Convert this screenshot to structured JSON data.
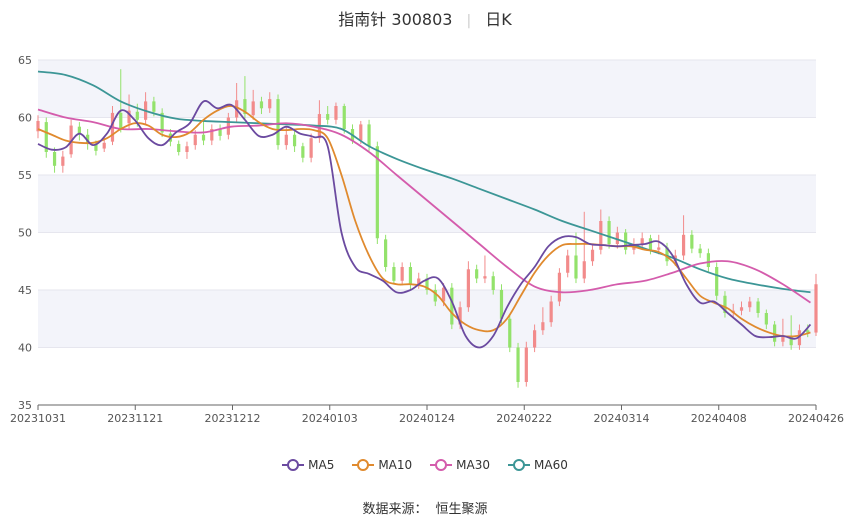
{
  "header": {
    "name": "指南针 300803",
    "period": "日K"
  },
  "source": {
    "label": "数据来源：",
    "provider": "恒生聚源"
  },
  "colors": {
    "up": "#f28b8b",
    "down": "#93e26b",
    "ma5": "#6b4aa0",
    "ma10": "#e08a2e",
    "ma30": "#d45cac",
    "ma60": "#3c9696",
    "band": "#f3f4fa",
    "grid": "#e6e6ee"
  },
  "chart_data": {
    "type": "candlestick",
    "y_ticks": [
      65,
      60,
      55,
      50,
      45,
      40,
      35
    ],
    "ylim": [
      35,
      65
    ],
    "x_ticks": [
      "20231031",
      "20231121",
      "20231212",
      "20240103",
      "20240124",
      "20240222",
      "20240314",
      "20240408",
      "20240426"
    ],
    "legend_position": "bottom",
    "ma_labels": {
      "ma5": "MA5",
      "ma10": "MA10",
      "ma30": "MA30",
      "ma60": "MA60"
    },
    "ma5": [
      [
        0,
        57.7
      ],
      [
        5,
        57.2
      ],
      [
        10,
        57.4
      ],
      [
        15,
        58.6
      ],
      [
        20,
        57.6
      ],
      [
        25,
        58.6
      ],
      [
        30,
        60.6
      ],
      [
        35,
        59.8
      ],
      [
        40,
        58.2
      ],
      [
        45,
        57.6
      ],
      [
        50,
        58.7
      ],
      [
        55,
        59.5
      ],
      [
        60,
        61.4
      ],
      [
        65,
        60.8
      ],
      [
        70,
        61.1
      ],
      [
        75,
        59.8
      ],
      [
        80,
        58.4
      ],
      [
        85,
        58.5
      ],
      [
        90,
        59.2
      ],
      [
        95,
        58.6
      ],
      [
        100,
        58.3
      ],
      [
        105,
        57.5
      ],
      [
        110,
        50.0
      ],
      [
        115,
        47.0
      ],
      [
        120,
        46.4
      ],
      [
        125,
        45.8
      ],
      [
        130,
        44.8
      ],
      [
        135,
        45.0
      ],
      [
        140,
        45.8
      ],
      [
        145,
        46.0
      ],
      [
        150,
        44.0
      ],
      [
        155,
        41.0
      ],
      [
        160,
        40.0
      ],
      [
        165,
        41.0
      ],
      [
        170,
        43.5
      ],
      [
        175,
        45.5
      ],
      [
        180,
        47.0
      ],
      [
        185,
        48.8
      ],
      [
        190,
        49.6
      ],
      [
        195,
        49.6
      ],
      [
        200,
        49.0
      ],
      [
        205,
        48.9
      ],
      [
        210,
        48.8
      ],
      [
        215,
        48.9
      ],
      [
        220,
        49.0
      ],
      [
        225,
        49.2
      ],
      [
        230,
        48.0
      ],
      [
        235,
        45.5
      ],
      [
        240,
        43.9
      ],
      [
        245,
        44.0
      ],
      [
        250,
        43.0
      ],
      [
        255,
        42.0
      ],
      [
        260,
        41.0
      ],
      [
        265,
        40.9
      ],
      [
        270,
        41.0
      ],
      [
        275,
        40.8
      ],
      [
        280,
        42.0
      ]
    ],
    "ma10": [
      [
        0,
        59.0
      ],
      [
        5,
        58.5
      ],
      [
        10,
        58.0
      ],
      [
        15,
        57.8
      ],
      [
        20,
        57.8
      ],
      [
        25,
        58.2
      ],
      [
        30,
        59.0
      ],
      [
        35,
        59.5
      ],
      [
        40,
        59.3
      ],
      [
        45,
        58.5
      ],
      [
        50,
        58.3
      ],
      [
        55,
        58.7
      ],
      [
        60,
        59.8
      ],
      [
        65,
        60.6
      ],
      [
        70,
        61.0
      ],
      [
        75,
        60.5
      ],
      [
        80,
        59.6
      ],
      [
        85,
        59.0
      ],
      [
        90,
        58.9
      ],
      [
        95,
        59.0
      ],
      [
        100,
        58.9
      ],
      [
        105,
        58.2
      ],
      [
        110,
        55.0
      ],
      [
        115,
        51.0
      ],
      [
        120,
        48.0
      ],
      [
        125,
        46.0
      ],
      [
        130,
        45.5
      ],
      [
        135,
        45.5
      ],
      [
        140,
        45.3
      ],
      [
        145,
        44.5
      ],
      [
        150,
        43.0
      ],
      [
        155,
        42.0
      ],
      [
        160,
        41.5
      ],
      [
        165,
        41.5
      ],
      [
        170,
        42.5
      ],
      [
        175,
        44.5
      ],
      [
        180,
        46.5
      ],
      [
        185,
        48.0
      ],
      [
        190,
        48.9
      ],
      [
        195,
        49.0
      ],
      [
        200,
        49.0
      ],
      [
        205,
        48.9
      ],
      [
        210,
        48.8
      ],
      [
        215,
        48.8
      ],
      [
        220,
        48.5
      ],
      [
        225,
        48.3
      ],
      [
        230,
        47.5
      ],
      [
        235,
        46.0
      ],
      [
        240,
        44.5
      ],
      [
        245,
        43.9
      ],
      [
        250,
        43.4
      ],
      [
        255,
        42.5
      ],
      [
        260,
        41.8
      ],
      [
        265,
        41.3
      ],
      [
        270,
        41.0
      ],
      [
        275,
        41.0
      ],
      [
        280,
        41.3
      ]
    ],
    "ma30": [
      [
        0,
        60.7
      ],
      [
        10,
        60.0
      ],
      [
        20,
        59.6
      ],
      [
        30,
        59.0
      ],
      [
        40,
        59.0
      ],
      [
        50,
        58.8
      ],
      [
        60,
        58.7
      ],
      [
        70,
        59.2
      ],
      [
        80,
        59.3
      ],
      [
        90,
        59.5
      ],
      [
        100,
        59.2
      ],
      [
        110,
        58.5
      ],
      [
        120,
        57.0
      ],
      [
        130,
        55.0
      ],
      [
        140,
        53.0
      ],
      [
        150,
        51.0
      ],
      [
        160,
        49.0
      ],
      [
        170,
        47.0
      ],
      [
        180,
        45.3
      ],
      [
        190,
        44.8
      ],
      [
        200,
        45.0
      ],
      [
        210,
        45.5
      ],
      [
        220,
        45.8
      ],
      [
        230,
        46.5
      ],
      [
        240,
        47.3
      ],
      [
        250,
        47.5
      ],
      [
        260,
        46.8
      ],
      [
        270,
        45.5
      ],
      [
        280,
        43.9
      ]
    ],
    "ma60": [
      [
        0,
        64.0
      ],
      [
        10,
        63.7
      ],
      [
        20,
        62.8
      ],
      [
        30,
        61.4
      ],
      [
        40,
        60.5
      ],
      [
        50,
        59.9
      ],
      [
        60,
        59.7
      ],
      [
        70,
        59.6
      ],
      [
        80,
        59.5
      ],
      [
        90,
        59.4
      ],
      [
        100,
        59.3
      ],
      [
        110,
        59.0
      ],
      [
        120,
        57.5
      ],
      [
        130,
        56.4
      ],
      [
        140,
        55.5
      ],
      [
        150,
        54.7
      ],
      [
        160,
        53.8
      ],
      [
        170,
        52.9
      ],
      [
        180,
        52.0
      ],
      [
        190,
        51.0
      ],
      [
        200,
        50.2
      ],
      [
        210,
        49.4
      ],
      [
        220,
        48.6
      ],
      [
        230,
        47.8
      ],
      [
        240,
        46.8
      ],
      [
        250,
        46.0
      ],
      [
        260,
        45.5
      ],
      [
        270,
        45.1
      ],
      [
        280,
        44.8
      ]
    ],
    "candles_note_only": "",
    "candles": [
      [
        0,
        58.8,
        59.7,
        58.2,
        60.2
      ],
      [
        3,
        59.6,
        57.0,
        56.5,
        60.0
      ],
      [
        6,
        57.0,
        55.8,
        55.2,
        57.4
      ],
      [
        9,
        55.8,
        56.6,
        55.2,
        57.1
      ],
      [
        12,
        56.8,
        59.3,
        56.5,
        59.8
      ],
      [
        15,
        59.2,
        58.6,
        58.0,
        59.6
      ],
      [
        18,
        58.5,
        57.8,
        57.2,
        59.0
      ],
      [
        21,
        57.7,
        57.1,
        56.7,
        58.0
      ],
      [
        24,
        57.3,
        57.8,
        57.0,
        58.3
      ],
      [
        27,
        57.9,
        60.4,
        57.6,
        61.0
      ],
      [
        30,
        60.4,
        59.0,
        58.7,
        64.2
      ],
      [
        33,
        59.5,
        60.6,
        59.0,
        62.0
      ],
      [
        36,
        60.5,
        59.8,
        59.2,
        61.2
      ],
      [
        39,
        59.8,
        61.4,
        59.4,
        62.2
      ],
      [
        42,
        61.4,
        60.5,
        60.1,
        61.8
      ],
      [
        45,
        60.4,
        58.7,
        58.3,
        60.8
      ],
      [
        48,
        58.6,
        57.9,
        57.5,
        59.0
      ],
      [
        51,
        57.7,
        57.0,
        56.7,
        58.0
      ],
      [
        54,
        57.0,
        57.5,
        56.4,
        57.9
      ],
      [
        57,
        57.6,
        58.5,
        57.2,
        58.9
      ],
      [
        60,
        58.5,
        58.0,
        57.6,
        59.8
      ],
      [
        63,
        58.0,
        59.0,
        57.6,
        59.4
      ],
      [
        66,
        59.0,
        58.4,
        58.0,
        59.4
      ],
      [
        69,
        58.5,
        60.0,
        58.1,
        60.4
      ],
      [
        72,
        60.0,
        61.5,
        59.6,
        63.0
      ],
      [
        75,
        61.6,
        60.3,
        59.9,
        63.6
      ],
      [
        78,
        60.2,
        61.4,
        59.8,
        62.4
      ],
      [
        81,
        61.4,
        60.8,
        60.3,
        61.8
      ],
      [
        84,
        60.8,
        61.6,
        60.4,
        62.2
      ],
      [
        87,
        61.6,
        57.6,
        57.2,
        62.0
      ],
      [
        90,
        57.6,
        58.5,
        57.2,
        59.2
      ],
      [
        93,
        58.5,
        57.5,
        57.0,
        58.9
      ],
      [
        96,
        57.5,
        56.5,
        56.1,
        57.8
      ],
      [
        99,
        56.5,
        58.2,
        56.1,
        58.6
      ],
      [
        102,
        58.2,
        60.3,
        57.8,
        61.5
      ],
      [
        105,
        60.3,
        59.8,
        59.4,
        61.0
      ],
      [
        108,
        59.8,
        61.0,
        59.4,
        61.3
      ],
      [
        111,
        61.0,
        59.0,
        58.6,
        61.2
      ],
      [
        114,
        59.0,
        58.0,
        57.7,
        59.4
      ],
      [
        117,
        58.0,
        59.4,
        57.7,
        59.7
      ],
      [
        120,
        59.4,
        57.5,
        57.1,
        59.8
      ],
      [
        123,
        57.5,
        49.5,
        49.0,
        57.9
      ],
      [
        126,
        49.4,
        47.0,
        46.6,
        49.8
      ],
      [
        129,
        47.0,
        45.8,
        45.5,
        47.4
      ],
      [
        132,
        45.8,
        47.0,
        45.4,
        47.4
      ],
      [
        135,
        47.0,
        45.5,
        45.0,
        47.4
      ],
      [
        138,
        45.5,
        46.0,
        45.1,
        46.5
      ],
      [
        141,
        46.0,
        45.0,
        44.6,
        46.4
      ],
      [
        144,
        45.0,
        44.0,
        43.6,
        45.5
      ],
      [
        147,
        44.0,
        45.2,
        43.6,
        45.6
      ],
      [
        150,
        45.2,
        42.0,
        41.6,
        45.6
      ],
      [
        153,
        42.0,
        43.5,
        41.6,
        44.0
      ],
      [
        156,
        43.5,
        46.8,
        43.1,
        47.5
      ],
      [
        159,
        46.8,
        46.0,
        45.6,
        47.2
      ],
      [
        162,
        46.0,
        46.2,
        45.6,
        48.0
      ],
      [
        165,
        46.2,
        45.0,
        44.6,
        46.6
      ],
      [
        168,
        45.0,
        42.5,
        42.1,
        45.5
      ],
      [
        171,
        42.5,
        40.0,
        39.6,
        42.8
      ],
      [
        174,
        40.0,
        37.0,
        36.5,
        40.4
      ],
      [
        177,
        37.0,
        40.0,
        36.6,
        40.5
      ],
      [
        180,
        40.0,
        41.5,
        39.6,
        42.0
      ],
      [
        183,
        41.5,
        42.2,
        41.1,
        43.5
      ],
      [
        186,
        42.2,
        44.0,
        41.8,
        44.5
      ],
      [
        189,
        44.0,
        46.5,
        43.6,
        46.9
      ],
      [
        192,
        46.5,
        48.0,
        46.1,
        48.5
      ],
      [
        195,
        48.0,
        46.0,
        45.6,
        50.0
      ],
      [
        198,
        46.0,
        47.5,
        45.6,
        51.8
      ],
      [
        201,
        47.5,
        48.5,
        47.1,
        49.0
      ],
      [
        204,
        48.5,
        51.0,
        48.1,
        52.0
      ],
      [
        207,
        51.0,
        49.0,
        48.6,
        51.4
      ],
      [
        210,
        49.0,
        50.0,
        48.6,
        50.5
      ],
      [
        213,
        50.0,
        48.5,
        48.1,
        50.3
      ],
      [
        216,
        48.5,
        49.0,
        48.1,
        49.5
      ],
      [
        219,
        49.0,
        49.5,
        48.6,
        50.0
      ],
      [
        222,
        49.5,
        48.5,
        48.1,
        49.8
      ],
      [
        225,
        48.5,
        48.7,
        48.1,
        49.8
      ],
      [
        228,
        48.7,
        47.5,
        47.1,
        49.1
      ],
      [
        231,
        47.5,
        48.0,
        47.1,
        48.5
      ],
      [
        234,
        48.0,
        49.8,
        47.6,
        51.5
      ],
      [
        237,
        49.8,
        48.6,
        48.2,
        50.2
      ],
      [
        240,
        48.6,
        48.2,
        47.8,
        49.0
      ],
      [
        243,
        48.2,
        47.0,
        46.6,
        48.6
      ],
      [
        246,
        47.0,
        44.5,
        44.1,
        47.4
      ],
      [
        249,
        44.5,
        43.0,
        42.6,
        44.9
      ],
      [
        252,
        43.0,
        43.2,
        42.6,
        43.8
      ],
      [
        255,
        43.2,
        43.5,
        42.8,
        44.0
      ],
      [
        258,
        43.5,
        44.0,
        43.1,
        44.4
      ],
      [
        261,
        44.0,
        43.0,
        42.6,
        44.3
      ],
      [
        264,
        43.0,
        42.0,
        41.6,
        43.3
      ],
      [
        267,
        42.0,
        40.5,
        40.1,
        42.3
      ],
      [
        270,
        40.5,
        41.0,
        40.1,
        42.5
      ],
      [
        273,
        41.0,
        40.2,
        39.8,
        42.8
      ],
      [
        276,
        40.2,
        41.5,
        39.8,
        42.0
      ],
      [
        279,
        41.5,
        41.3,
        40.9,
        42.0
      ],
      [
        282,
        41.3,
        45.5,
        41.0,
        46.4
      ]
    ]
  }
}
